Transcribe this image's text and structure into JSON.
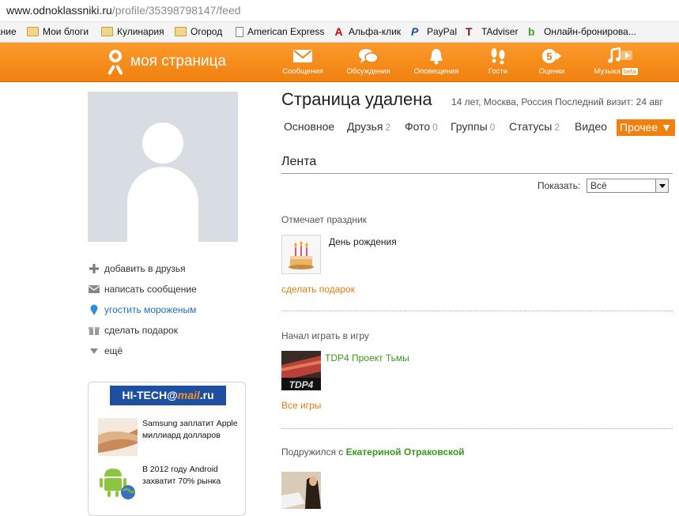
{
  "browser": {
    "url_domain": "www.odnoklassniki.ru",
    "url_path": "/profile/35398798147/feed",
    "bookmarks": [
      {
        "label": "ание",
        "icon": "folder-icon"
      },
      {
        "label": "Мои блоги",
        "icon": "folder-icon"
      },
      {
        "label": "Кулинария",
        "icon": "folder-icon"
      },
      {
        "label": "Огород",
        "icon": "folder-icon"
      },
      {
        "label": "American Express",
        "icon": "page-icon"
      },
      {
        "label": "Альфа-клик",
        "icon": "alfa-icon",
        "glyph": "А"
      },
      {
        "label": "PayPal",
        "icon": "paypal-icon",
        "glyph": "P"
      },
      {
        "label": "TAdviser",
        "icon": "tadviser-icon",
        "glyph": "T"
      },
      {
        "label": "Онлайн-бронирова...",
        "icon": "booking-icon",
        "glyph": "b"
      }
    ]
  },
  "topnav": {
    "brand": "моя страница",
    "items": [
      {
        "label": "Сообщения",
        "icon": "envelope-icon"
      },
      {
        "label": "Обсуждения",
        "icon": "chat-bubbles-icon"
      },
      {
        "label": "Оповещения",
        "icon": "bell-icon"
      },
      {
        "label": "Гости",
        "icon": "footprints-icon"
      },
      {
        "label": "Оценки",
        "icon": "rating-five-icon",
        "glyph": "5"
      },
      {
        "label": "Музыка",
        "icon": "music-icon",
        "badge": "beta"
      }
    ],
    "colors": {
      "bar": "#f0810f"
    }
  },
  "sidebar": {
    "actions": [
      {
        "label": "добавить в друзья",
        "icon": "plus-icon"
      },
      {
        "label": "написать сообщение",
        "icon": "envelope-icon"
      },
      {
        "label": "угостить мороженым",
        "icon": "ice-cream-icon"
      },
      {
        "label": "сделать подарок",
        "icon": "gift-icon"
      },
      {
        "label": "ещё",
        "icon": "triangle-down-icon"
      }
    ],
    "news": {
      "logo_main": "HI-TECH",
      "logo_at": "@",
      "logo_mail": "mail",
      "logo_tld": ".ru",
      "items": [
        {
          "text": "Samsung заплатит Apple миллиард долларов",
          "thumb": "handshake-thumb"
        },
        {
          "text": "В 2012 году Android захватит 70% рынка",
          "thumb": "android-thumb"
        }
      ]
    }
  },
  "profile": {
    "name": "Страница удалена",
    "meta": "14 лет, Москва, Россия  Последний визит: 24 авг",
    "tabs": [
      {
        "label": "Основное",
        "count": ""
      },
      {
        "label": "Друзья",
        "count": "2"
      },
      {
        "label": "Фото",
        "count": "0"
      },
      {
        "label": "Группы",
        "count": "0"
      },
      {
        "label": "Статусы",
        "count": "2"
      },
      {
        "label": "Видео",
        "count": ""
      }
    ],
    "more_label": "Прочее ▼"
  },
  "feed": {
    "heading": "Лента",
    "show_label": "Показать:",
    "show_value": "Всё",
    "events": [
      {
        "title": "Отмечает праздник",
        "item": "День рождения",
        "link": "сделать подарок"
      },
      {
        "title": "Начал играть в игру",
        "item": "TDP4 Проект Тьмы",
        "link": "Все игры",
        "game_logo": "TDP4"
      },
      {
        "title_prefix": "Подружился с",
        "friend": "Екатериной Отраковской"
      }
    ]
  }
}
